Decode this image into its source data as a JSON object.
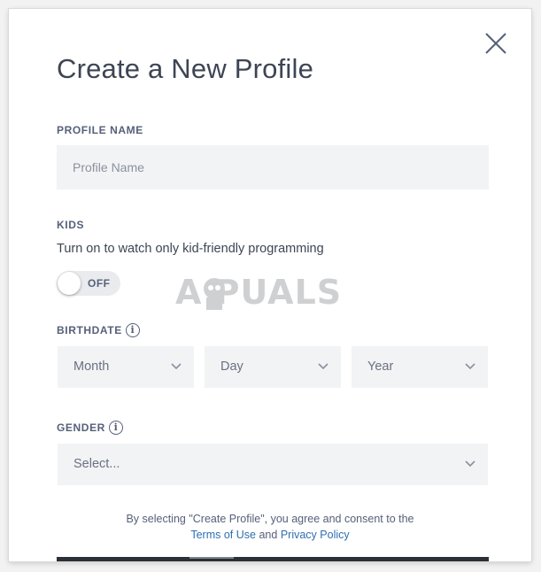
{
  "dialog": {
    "title": "Create a New Profile",
    "close_icon": "close-icon"
  },
  "profile_name": {
    "label": "PROFILE NAME",
    "placeholder": "Profile Name",
    "value": ""
  },
  "kids": {
    "label": "KIDS",
    "description": "Turn on to watch only kid-friendly programming",
    "toggle_state": "OFF"
  },
  "birthdate": {
    "label": "BIRTHDATE",
    "info_icon": "i",
    "month": "Month",
    "day": "Day",
    "year": "Year"
  },
  "gender": {
    "label": "GENDER",
    "info_icon": "i",
    "selected": "Select..."
  },
  "consent": {
    "line1": "By selecting \"Create Profile\", you agree and consent to the",
    "terms_link": "Terms of Use",
    "and_text": "and",
    "privacy_link": "Privacy Policy"
  },
  "watermark": {
    "text": "A  PUALS"
  },
  "colors": {
    "text": "#3d4554",
    "label": "#56607a",
    "field_bg": "#f2f3f5",
    "link": "#2f6fb0",
    "button_bar": "#2b2f36"
  }
}
